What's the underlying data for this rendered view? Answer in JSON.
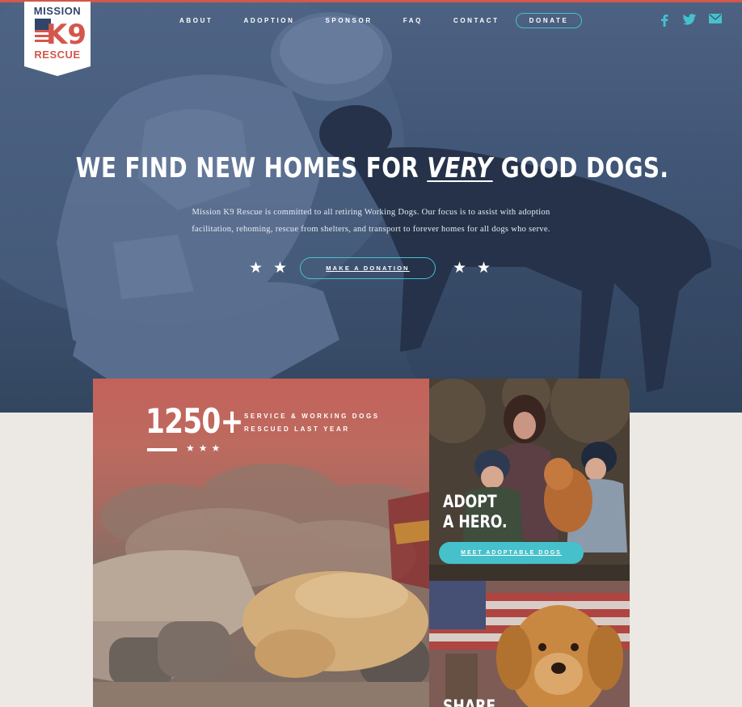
{
  "logo": {
    "line1": "MISSION",
    "line2": "K9",
    "line3": "RESCUE"
  },
  "nav": {
    "items": [
      {
        "label": "ABOUT"
      },
      {
        "label": "ADOPTION"
      },
      {
        "label": "SPONSOR"
      },
      {
        "label": "FAQ"
      },
      {
        "label": "CONTACT"
      }
    ],
    "donate_label": "DONATE"
  },
  "social": {
    "icons": [
      "facebook-icon",
      "twitter-icon",
      "email-icon"
    ]
  },
  "hero": {
    "headline_before": "WE FIND NEW HOMES FOR ",
    "headline_emphasis": "VERY",
    "headline_after": " GOOD DOGS.",
    "intro_line1": "Mission K9 Rescue is committed to all retiring Working Dogs. Our focus is to assist with adoption",
    "intro_line2": "facilitation, rehoming, rescue from shelters, and transport to forever homes for all dogs who serve.",
    "cta_label": "MAKE A DONATION",
    "star_glyph": "★"
  },
  "stats": {
    "number": "1250+",
    "caption_line1": "SERVICE & WORKING DOGS",
    "caption_line2": "RESCUED LAST YEAR",
    "stars": "★★★"
  },
  "adopt": {
    "title_line1": "ADOPT",
    "title_line2": "A HERO.",
    "button_label": "MEET ADOPTABLE DOGS"
  },
  "share": {
    "title_line1": "SHARE"
  },
  "colors": {
    "accent": "#46c1cc",
    "brand_red": "#d3574b",
    "hero_blue": "#415676",
    "page_bg": "#ece8e3"
  }
}
